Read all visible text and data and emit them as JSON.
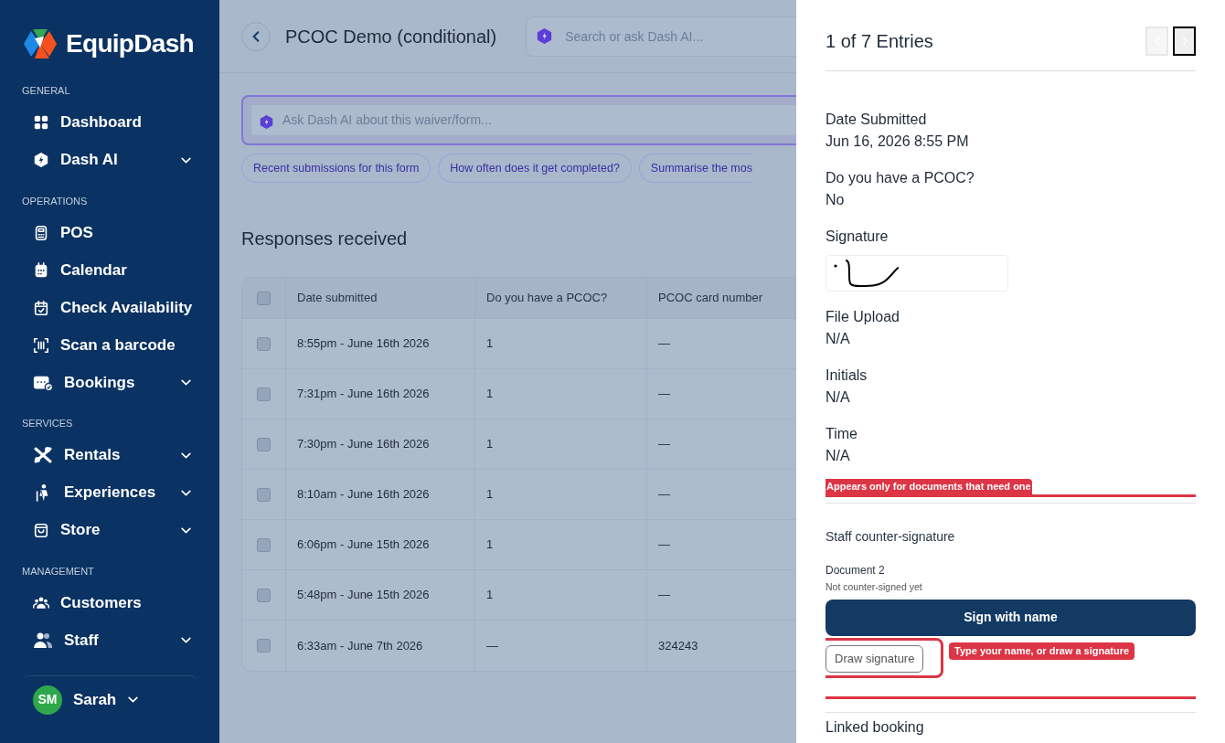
{
  "app": {
    "name": "EquipDash"
  },
  "sidebar": {
    "sections": [
      {
        "heading": "GENERAL",
        "items": [
          {
            "label": "Dashboard",
            "has_submenu": false
          },
          {
            "label": "Dash AI",
            "has_submenu": true
          }
        ]
      },
      {
        "heading": "OPERATIONS",
        "items": [
          {
            "label": "POS",
            "has_submenu": false
          },
          {
            "label": "Calendar",
            "has_submenu": false
          },
          {
            "label": "Check Availability",
            "has_submenu": false
          },
          {
            "label": "Scan a barcode",
            "has_submenu": false
          },
          {
            "label": "Bookings",
            "has_submenu": true
          }
        ]
      },
      {
        "heading": "SERVICES",
        "items": [
          {
            "label": "Rentals",
            "has_submenu": true
          },
          {
            "label": "Experiences",
            "has_submenu": true
          },
          {
            "label": "Store",
            "has_submenu": true
          }
        ]
      },
      {
        "heading": "MANAGEMENT",
        "items": [
          {
            "label": "Customers",
            "has_submenu": false
          },
          {
            "label": "Staff",
            "has_submenu": true
          }
        ]
      }
    ]
  },
  "user": {
    "initials": "SM",
    "name": "Sarah"
  },
  "header": {
    "title": "PCOC Demo (conditional)",
    "search": {
      "placeholder": "Search or ask Dash AI..."
    }
  },
  "ai_prompt": {
    "placeholder": "Ask Dash AI about this waiver/form..."
  },
  "suggestions": [
    "Recent submissions for this form",
    "How often does it get completed?",
    "Summarise the mos"
  ],
  "responses": {
    "title": "Responses received",
    "select_all_checked": false,
    "columns": [
      "Date submitted",
      "Do you have a PCOC?",
      "PCOC card number"
    ],
    "rows": [
      {
        "checked": false,
        "cells": [
          "8:55pm - June 16th 2026",
          "1",
          "—"
        ]
      },
      {
        "checked": false,
        "cells": [
          "7:31pm - June 16th 2026",
          "1",
          "—"
        ]
      },
      {
        "checked": false,
        "cells": [
          "7:30pm - June 16th 2026",
          "1",
          "—"
        ]
      },
      {
        "checked": false,
        "cells": [
          "8:10am - June 16th 2026",
          "1",
          "—"
        ]
      },
      {
        "checked": false,
        "cells": [
          "6:06pm - June 15th 2026",
          "1",
          "—"
        ]
      },
      {
        "checked": false,
        "cells": [
          "5:48pm - June 15th 2026",
          "1",
          "—"
        ]
      },
      {
        "checked": false,
        "cells": [
          "6:33am - June 7th 2026",
          "—",
          "324243"
        ]
      }
    ]
  },
  "drawer": {
    "counter": "1 of 7 Entries",
    "previous_disabled": true,
    "next_disabled": false,
    "fields": [
      {
        "kind": "text",
        "label": "Date Submitted",
        "value": "Jun 16, 2026 8:55 PM"
      },
      {
        "kind": "text",
        "label": "Do you have a PCOC?",
        "value": "No"
      },
      {
        "kind": "signature",
        "label": "Signature"
      },
      {
        "kind": "text",
        "label": "File Upload",
        "value": "N/A"
      },
      {
        "kind": "text",
        "label": "Initials",
        "value": "N/A"
      },
      {
        "kind": "text",
        "label": "Time",
        "value": "N/A"
      }
    ],
    "annotation_top": "Appears only for documents that need one",
    "counter_signature": {
      "title": "Staff counter-signature",
      "document": "Document 2",
      "status": "Not counter-signed yet",
      "primary_button": "Sign with name",
      "secondary_button": "Draw signature",
      "annotation": "Type your name, or draw a signature"
    },
    "next_section": "Linked booking"
  }
}
